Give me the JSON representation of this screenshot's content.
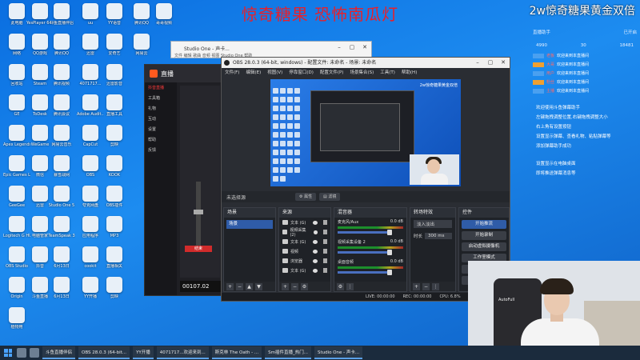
{
  "overlay": {
    "title": "惊奇糖果 恐怖南瓜灯",
    "promo": "2w惊奇糖果黄金双倍"
  },
  "desktop_icons": [
    {
      "label": "此电脑"
    },
    {
      "label": "YesPlayer 64 Bit"
    },
    {
      "label": "斗鱼直播伴侣"
    },
    {
      "label": "uu"
    },
    {
      "label": "YY语音"
    },
    {
      "label": "腾讯QQ"
    },
    {
      "label": "哥哥视频"
    },
    {
      "label": "网络"
    },
    {
      "label": "QQ游戏"
    },
    {
      "label": "腾讯QQ"
    },
    {
      "label": "迅雷"
    },
    {
      "label": "爱奇艺"
    },
    {
      "label": "网易云"
    },
    {
      "label": "回收站"
    },
    {
      "label": "Steam"
    },
    {
      "label": "腾讯视频"
    },
    {
      "label": "4071717..."
    },
    {
      "label": "迅雷影音"
    },
    {
      "label": "GE"
    },
    {
      "label": "ToDesk"
    },
    {
      "label": "腾讯会议"
    },
    {
      "label": "Adobe Audit..."
    },
    {
      "label": "直播工具"
    },
    {
      "label": "Apex Legends"
    },
    {
      "label": "WeGame"
    },
    {
      "label": "网易云音乐"
    },
    {
      "label": "CapCut"
    },
    {
      "label": "剪映"
    },
    {
      "label": "Epic Games Launcher"
    },
    {
      "label": "微信"
    },
    {
      "label": "暴雪战网"
    },
    {
      "label": "OBS"
    },
    {
      "label": "KOOK"
    },
    {
      "label": "GeeGee"
    },
    {
      "label": "迅雷"
    },
    {
      "label": "Studio One 5"
    },
    {
      "label": "夸克网盘"
    },
    {
      "label": "OBS插件"
    },
    {
      "label": "Logitech G HUB"
    },
    {
      "label": "电脑管家"
    },
    {
      "label": "TeamSpeak 3"
    },
    {
      "label": "应用程序"
    },
    {
      "label": "MP3"
    },
    {
      "label": "OBS Studio"
    },
    {
      "label": "抖音"
    },
    {
      "label": "6月13日"
    },
    {
      "label": "cookit"
    },
    {
      "label": "直播相关"
    },
    {
      "label": "Origin"
    },
    {
      "label": "斗鱼直播"
    },
    {
      "label": "6月13日"
    },
    {
      "label": "YY开播"
    },
    {
      "label": "剪映"
    },
    {
      "label": "植物用"
    }
  ],
  "studio_one": {
    "title": "Studio One - 声卡...",
    "menu": "文件  编辑  歌曲  音频  视图  Studio One  帮助"
  },
  "live_helper": {
    "title": "直播",
    "side_items": [
      "抖音直播",
      "工具箱",
      "礼物",
      "互动",
      "设置",
      "帮助",
      "反馈"
    ],
    "timer": "00107.02",
    "end_label": "结束"
  },
  "obs": {
    "title": "OBS 28.0.3 (64-bit, windows) - 配置文件: 未命名 - 场景: 未命名",
    "menu": [
      "文件(F)",
      "编辑(E)",
      "视图(V)",
      "停靠窗口(D)",
      "配置文件(P)",
      "场景集合(S)",
      "工具(T)",
      "帮助(H)"
    ],
    "preview_promo": "2w惊奇糖果黄金双倍",
    "no_source": "未选择源",
    "props_btn": "属性",
    "filters_btn": "滤镜",
    "scenes": {
      "header": "场景",
      "items": [
        "场景"
      ]
    },
    "sources": {
      "header": "来源",
      "items": [
        "文本 (G)",
        "视频采集 (2)",
        "文本 (G)",
        "视频",
        "浏览器",
        "文本 (G)"
      ]
    },
    "mixer": {
      "header": "混音器",
      "channels": [
        {
          "name": "麦克风/Aux",
          "db": "0.0 dB"
        },
        {
          "name": "视频采集设备 2",
          "db": "0.0 dB"
        },
        {
          "name": "桌面音频",
          "db": "0.0 dB"
        }
      ]
    },
    "transitions": {
      "header": "转场特效",
      "type": "淡入淡出",
      "duration_label": "时长",
      "duration": "300 ms"
    },
    "controls": {
      "header": "控件",
      "buttons": [
        "开始推流",
        "开始录制",
        "启动虚拟摄像机",
        "工作室模式",
        "设置",
        "退出"
      ]
    },
    "status": {
      "live": "LIVE: 00:00:00",
      "rec": "REC: 00:00:00",
      "cpu": "CPU: 6.8%"
    }
  },
  "chat_panel": {
    "tabs": [
      "直播助手",
      "已开启"
    ],
    "stats": [
      "4990",
      "30",
      "18481"
    ],
    "messages": [
      {
        "user": "老板",
        "text": "欢迎来到本直播间"
      },
      {
        "user": "大哥",
        "text": "欢迎来到本直播间"
      },
      {
        "user": "用户",
        "text": "欢迎来到本直播间"
      },
      {
        "user": "粉丝",
        "text": "欢迎来到本直播间"
      },
      {
        "user": "主播",
        "text": "欢迎来到本直播间"
      }
    ],
    "notes": [
      "欢迎使用斗鱼弹幕助手",
      "左键拖拽调整位置,右键拖拽调整大小",
      "右上角有设置按钮",
      "设置显示弹幕、查看礼物、粘贴弹幕等",
      "添加弹幕助手成功"
    ],
    "notes2": [
      "设置显示在电脑桌面",
      "即将推送弹幕消息等"
    ]
  },
  "taskbar": {
    "tasks": [
      "斗鱼直播伴侣",
      "OBS 28.0.3 (64-bit...",
      "YY开播",
      "4071717...欢迎来到...",
      "斯克林 The Oath - ...",
      "Sm插件直播_热门...",
      "Studio One - 声卡..."
    ]
  },
  "webcam": {
    "chair_text": "AutoFull"
  }
}
